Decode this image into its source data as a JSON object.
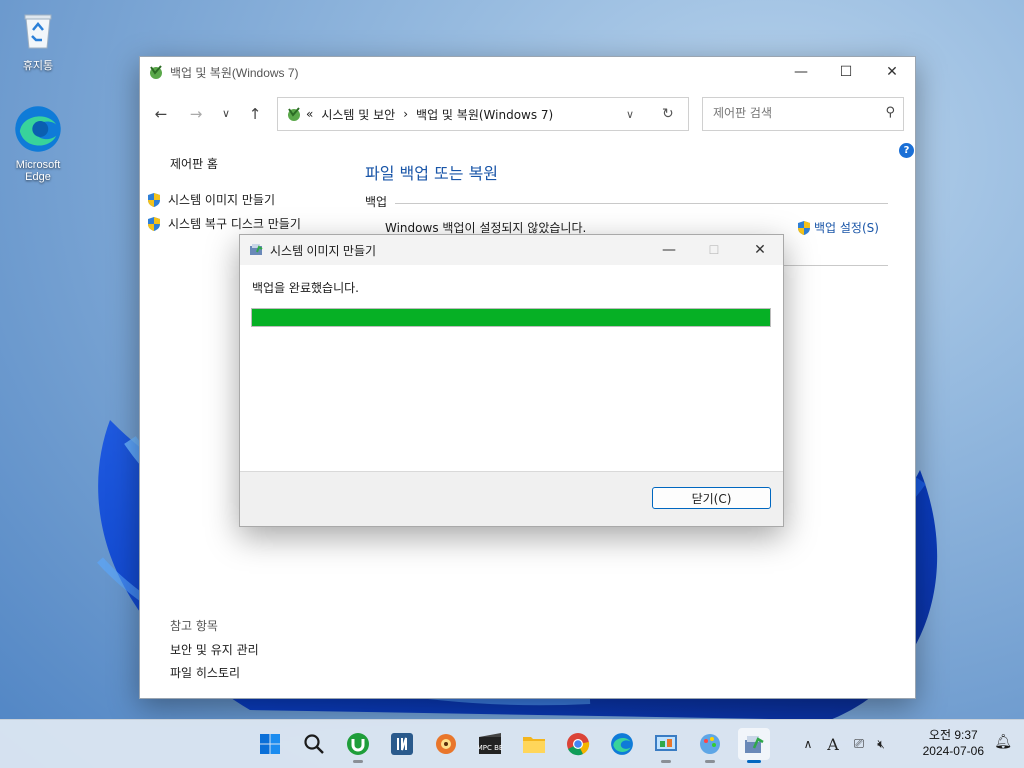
{
  "desktop": {
    "icons": [
      {
        "label": "휴지통",
        "icon": "recycle-bin-icon"
      },
      {
        "label": "Microsoft Edge",
        "icon": "edge-icon"
      }
    ]
  },
  "main_window": {
    "title": "백업 및 복원(Windows 7)",
    "address": {
      "prefix": "«",
      "crumbs": [
        "시스템 및 보안",
        "백업 및 복원(Windows 7)"
      ],
      "separator": "›"
    },
    "search_placeholder": "제어판 검색",
    "sidebar": {
      "home": "제어판 홈",
      "links": [
        "시스템 이미지 만들기",
        "시스템 복구 디스크 만들기"
      ],
      "see_also_title": "참고 항목",
      "see_also": [
        "보안 및 유지 관리",
        "파일 히스토리"
      ]
    },
    "content": {
      "heading": "파일 백업 또는 복원",
      "section": "백업",
      "status": "Windows 백업이 설정되지 않았습니다.",
      "setup_link": "백업 설정(S)"
    }
  },
  "dialog": {
    "title": "시스템 이미지 만들기",
    "message": "백업을 완료했습니다.",
    "progress": 1.0,
    "progress_color": "#06b025",
    "close_button": "닫기(C)"
  },
  "taskbar": {
    "apps": [
      "start-icon",
      "search-icon",
      "utorrent-icon",
      "onenote-icon",
      "photo-viewer-icon",
      "mpc-be-icon",
      "file-explorer-icon",
      "chrome-icon",
      "edge-icon",
      "control-panel-icon",
      "paint-icon",
      "backup-icon"
    ],
    "mpc_label": "MPC BE",
    "tray_ime": "A",
    "clock_time": "오전 9:37",
    "clock_date": "2024-07-06"
  },
  "colors": {
    "accent": "#0067c0",
    "link": "#1a56a8",
    "help": "#1a6fd6"
  }
}
